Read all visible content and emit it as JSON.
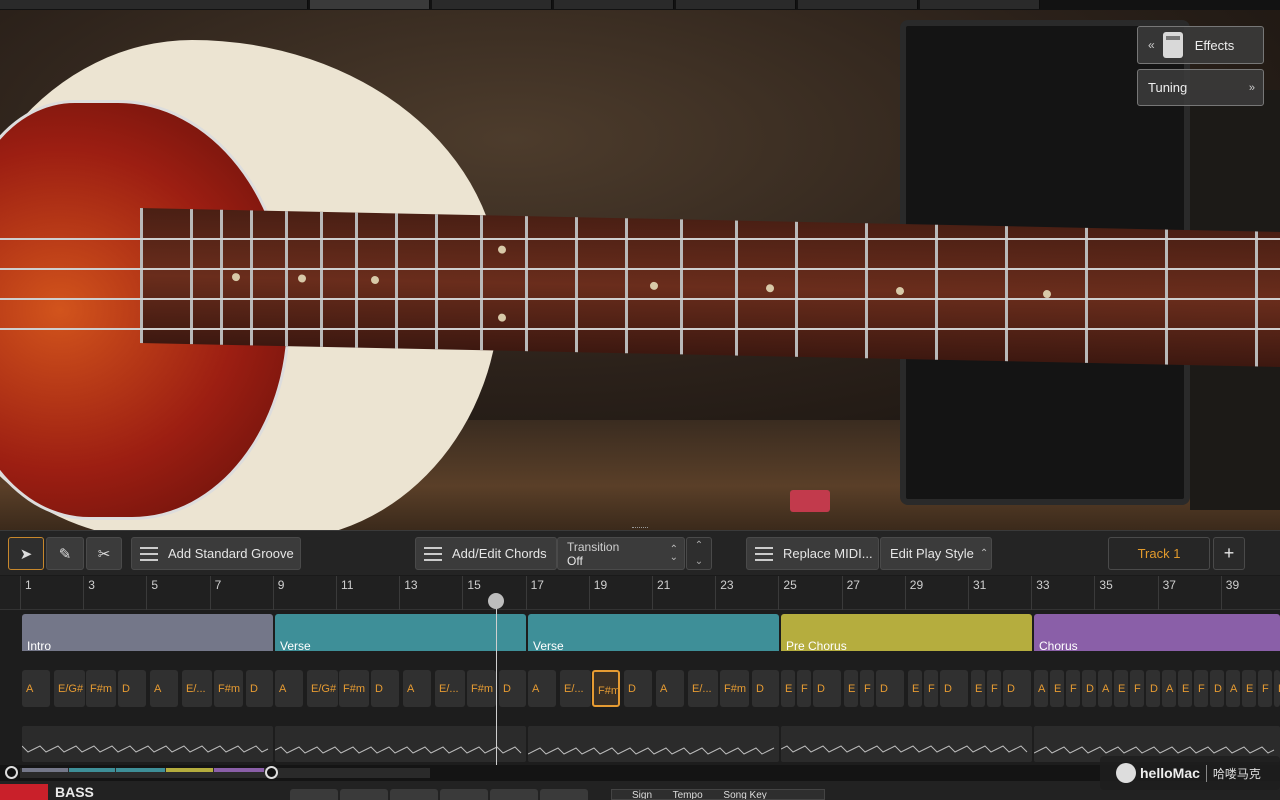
{
  "top_right": {
    "effects_label": "Effects",
    "tuning_label": "Tuning"
  },
  "toolbar": {
    "add_groove_label": "Add Standard Groove",
    "add_chords_label": "Add/Edit Chords",
    "transition_title": "Transition",
    "transition_value": "Off",
    "replace_midi_label": "Replace MIDI...",
    "play_style_label": "Edit Play Style",
    "track_tab_label": "Track 1",
    "add_track_label": "+"
  },
  "ruler": [
    "1",
    "3",
    "5",
    "7",
    "9",
    "11",
    "13",
    "15",
    "17",
    "19",
    "21",
    "23",
    "25",
    "27",
    "29",
    "31",
    "33",
    "35",
    "37",
    "39"
  ],
  "sections": [
    {
      "label": "Intro",
      "color": "#747789"
    },
    {
      "label": "Verse",
      "color": "#3e8f98"
    },
    {
      "label": "Verse",
      "color": "#3e8f98"
    },
    {
      "label": "Pre Chorus",
      "color": "#b5ad3e"
    },
    {
      "label": "Chorus",
      "color": "#8a5fa8"
    }
  ],
  "chords": [
    "A",
    "E/G#",
    "F#m",
    "D",
    "A",
    "E/...",
    "F#m",
    "D",
    "A",
    "E/G#",
    "F#m",
    "D",
    "A",
    "E/...",
    "F#m",
    "D",
    "A",
    "E/...",
    "F#m",
    "D",
    "A",
    "E/...",
    "F#m",
    "D",
    "E",
    "F",
    "D",
    "E",
    "F",
    "D",
    "E",
    "F",
    "D",
    "E",
    "F",
    "D",
    "A",
    "E",
    "F",
    "D",
    "A",
    "E",
    "F",
    "D",
    "A",
    "E",
    "F",
    "D",
    "A",
    "E",
    "F",
    "D"
  ],
  "bottom": {
    "plugin_name": "BASS",
    "info_sign": "Sign",
    "info_tempo": "Tempo",
    "info_key": "Song Key"
  },
  "watermark": {
    "brand": "helloMac",
    "cn": "哈喽马克"
  },
  "colors": {
    "accent": "#e69b32",
    "intro": "#747789",
    "verse": "#3e8f98",
    "prechorus": "#b5ad3e",
    "chorus": "#8a5fa8"
  }
}
